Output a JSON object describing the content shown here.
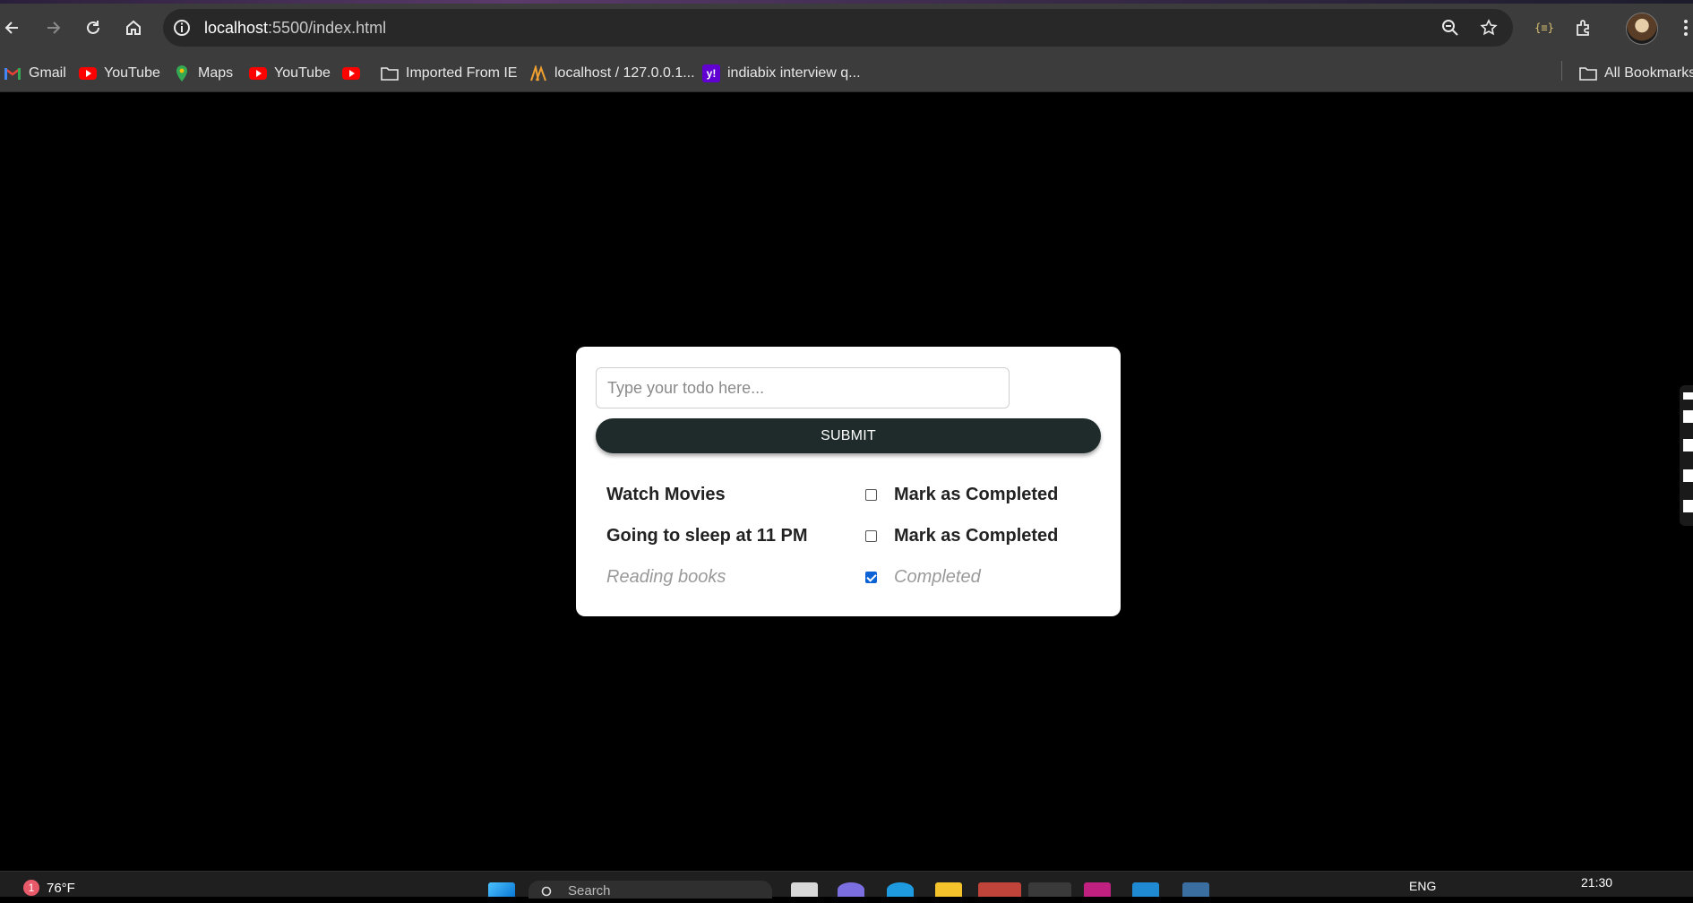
{
  "browser": {
    "url_host": "localhost",
    "url_rest": ":5500/index.html",
    "bookmarks": [
      {
        "label": "Gmail",
        "icon": "gmail-icon"
      },
      {
        "label": "YouTube",
        "icon": "youtube-icon"
      },
      {
        "label": "Maps",
        "icon": "maps-icon"
      },
      {
        "label": "YouTube",
        "icon": "youtube-icon"
      },
      {
        "label": "",
        "icon": "youtube-icon"
      },
      {
        "label": "Imported From IE",
        "icon": "folder-icon"
      },
      {
        "label": "localhost / 127.0.0.1...",
        "icon": "phpmyadmin-icon"
      },
      {
        "label": "indiabix interview q...",
        "icon": "yahoo-icon"
      }
    ],
    "all_bookmarks_label": "All Bookmarks"
  },
  "app": {
    "input_placeholder": "Type your todo here...",
    "input_value": "",
    "submit_label": "SUBMIT",
    "todos": [
      {
        "text": "Watch Movies",
        "completed": false,
        "status_label": "Mark as Completed"
      },
      {
        "text": "Going to sleep at 11 PM",
        "completed": false,
        "status_label": "Mark as Completed"
      },
      {
        "text": "Reading books",
        "completed": true,
        "status_label": "Completed"
      }
    ]
  },
  "taskbar": {
    "notification_count": "1",
    "weather": "76°F",
    "search_placeholder": "Search",
    "language": "ENG",
    "time": "21:30"
  },
  "colors": {
    "page_background": "#000000",
    "card_background": "#ffffff",
    "submit_background": "#1f2b2b",
    "checkbox_checked": "#0b63d6",
    "completed_text": "#9a9a9a"
  }
}
